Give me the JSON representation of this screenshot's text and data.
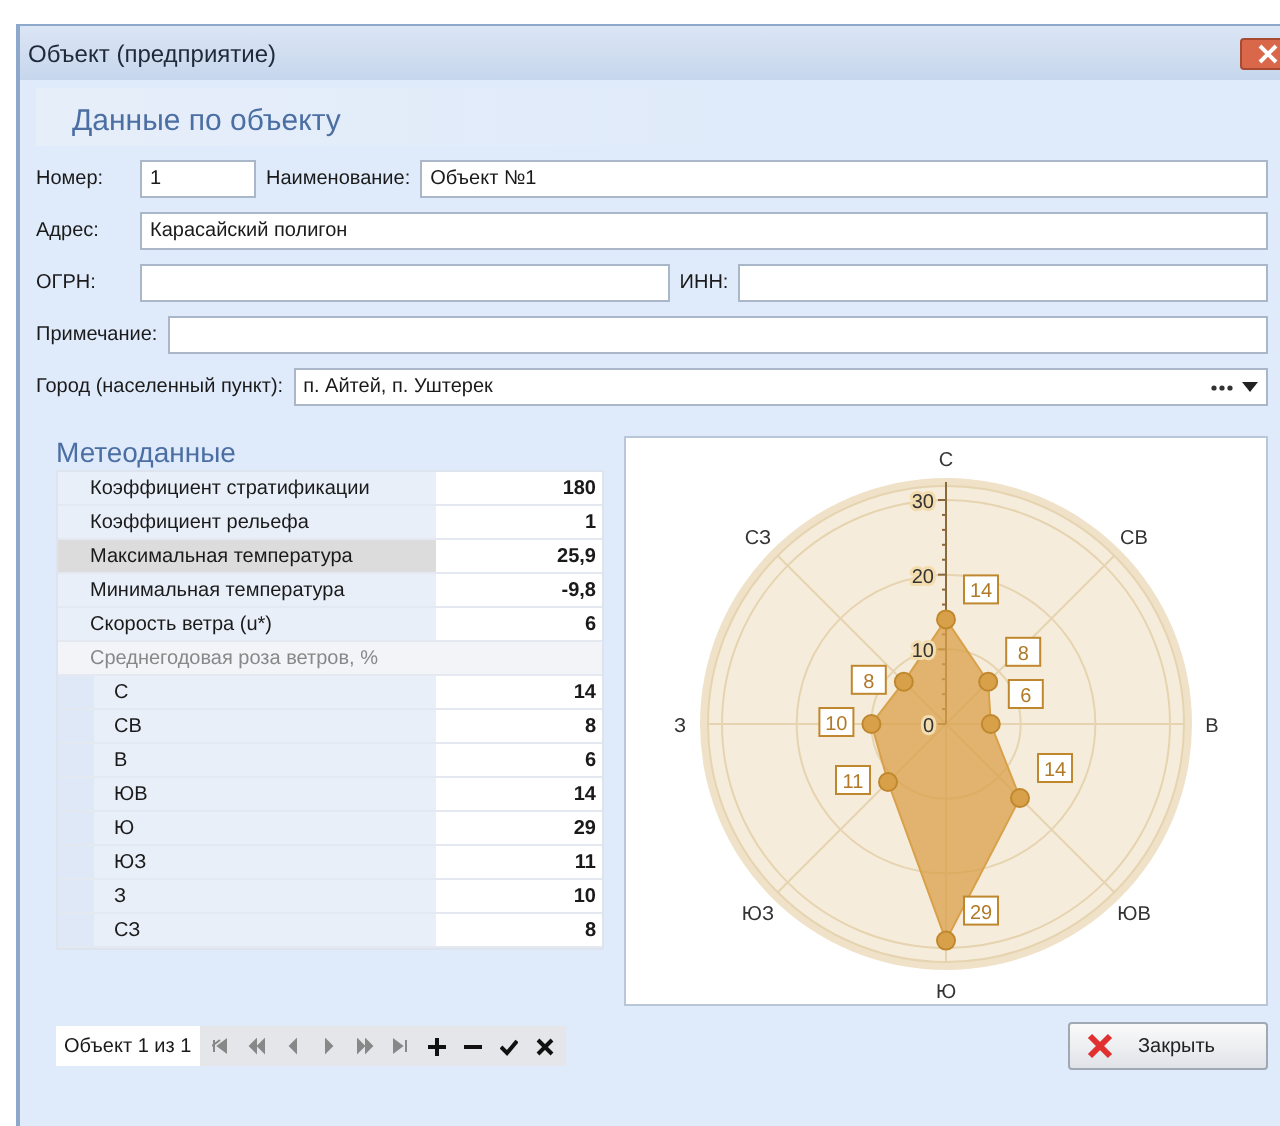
{
  "window": {
    "title": "Объект (предприятие)"
  },
  "object_group": {
    "title": "Данные по объекту",
    "rows": [
      {
        "fields": [
          {
            "label": "Номер:",
            "value": "1",
            "kind": "short"
          },
          {
            "label": "Наименование:",
            "value": "Объект №1",
            "kind": "text"
          }
        ]
      },
      {
        "fields": [
          {
            "label": "Адрес:",
            "value": "Карасайский полигон",
            "kind": "text"
          }
        ]
      },
      {
        "fields": [
          {
            "label": "ОГРН:",
            "kind": "text"
          },
          {
            "label": "ИНН:",
            "kind": "text"
          }
        ]
      },
      {
        "fields": [
          {
            "label": "Примечание:",
            "kind": "text"
          }
        ]
      },
      {
        "fields": [
          {
            "label": "Город (населенный пункт):",
            "value": "п. Айтей, п. Уштерек",
            "kind": "lookup"
          }
        ]
      }
    ]
  },
  "meteo": {
    "title": "Метеоданные",
    "properties": [
      {
        "label": "Коэффициент стратификации",
        "value": "180",
        "selected": false
      },
      {
        "label": "Коэффициент рельефа",
        "value": "1",
        "selected": false
      },
      {
        "label": "Максимальная температура",
        "value": "25,9",
        "selected": true
      },
      {
        "label": "Минимальная температура",
        "value": "-9,8",
        "selected": false
      },
      {
        "label": "Скорость ветра (u*)",
        "value": "6",
        "selected": false
      }
    ],
    "wind_rose": {
      "title": "Среднегодовая роза ветров, %",
      "rows": [
        {
          "label": "С",
          "value": "14"
        },
        {
          "label": "СВ",
          "value": "8"
        },
        {
          "label": "В",
          "value": "6"
        },
        {
          "label": "ЮВ",
          "value": "14"
        },
        {
          "label": "Ю",
          "value": "29"
        },
        {
          "label": "ЮЗ",
          "value": "11"
        },
        {
          "label": "З",
          "value": "10"
        },
        {
          "label": "СЗ",
          "value": "8"
        }
      ]
    },
    "wind_rose_chart": {
      "directions": [
        "С",
        "СВ",
        "В",
        "ЮВ",
        "Ю",
        "ЮЗ",
        "З",
        "СЗ"
      ],
      "axis_ticks": [
        "30",
        "20",
        "10",
        "0"
      ],
      "points": [
        {
          "value": "14"
        },
        {
          "value": "8"
        },
        {
          "value": "6"
        },
        {
          "value": "14"
        },
        {
          "value": "29"
        },
        {
          "value": "11"
        },
        {
          "value": "10"
        },
        {
          "value": "8"
        }
      ]
    }
  },
  "navigator": {
    "text": "Объект 1 из 1"
  },
  "close_button": {
    "label": "Закрыть"
  }
}
